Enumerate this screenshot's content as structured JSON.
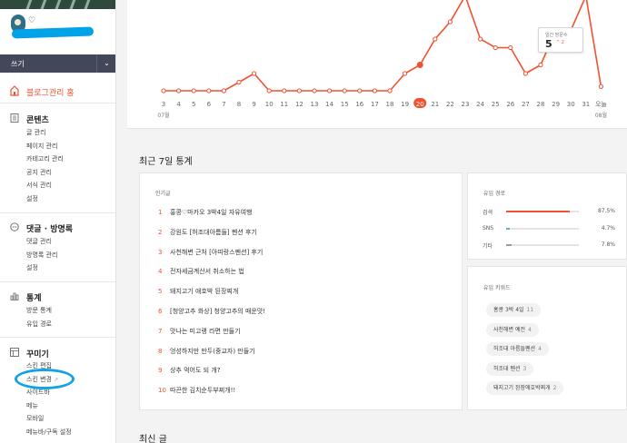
{
  "sidebar": {
    "profile_name": "♡",
    "write_label": "쓰기",
    "write_toggle": "⌄",
    "home_label": "블로그관리 홈",
    "sections": [
      {
        "title": "콘텐츠",
        "items": [
          "글 관리",
          "페이지 관리",
          "카테고리 관리",
          "공지 관리",
          "서식 관리",
          "설정"
        ]
      },
      {
        "title": "댓글 · 방명록",
        "items": [
          "댓글 관리",
          "방명록 관리",
          "설정"
        ]
      },
      {
        "title": "통계",
        "items": [
          "방문 통계",
          "유입 경로"
        ]
      },
      {
        "title": "꾸미기",
        "items": [
          "스킨 편집",
          "스킨 변경",
          "사이드바",
          "메뉴",
          "모바일",
          "메뉴바/구독 설정"
        ]
      }
    ]
  },
  "chart": {
    "tooltip_label": "일간 방문수",
    "tooltip_value": "5",
    "tooltip_delta": "^ 2",
    "highlight_label": "20",
    "month_start": "07월",
    "month_end": "08월"
  },
  "chart_data": {
    "type": "line",
    "x": [
      "3",
      "4",
      "5",
      "6",
      "7",
      "8",
      "9",
      "10",
      "11",
      "12",
      "13",
      "14",
      "15",
      "16",
      "17",
      "18",
      "19",
      "20",
      "21",
      "22",
      "23",
      "24",
      "25",
      "26",
      "27",
      "28",
      "29",
      "30",
      "31",
      "오늘"
    ],
    "series": [
      {
        "values": [
          0,
          0,
          0,
          0,
          0,
          1,
          2,
          0,
          0,
          0,
          0,
          0,
          0,
          0,
          0,
          0,
          2,
          3,
          6,
          8,
          11,
          6,
          5,
          5,
          2,
          3,
          7,
          7,
          11,
          0.5
        ]
      }
    ],
    "ylim": [
      0,
      12
    ],
    "highlight_index": 17,
    "line_color": "#f25130",
    "grid": false
  },
  "recent": {
    "section_title": "최근 7일 통계",
    "popular_title": "인기글",
    "posts": [
      {
        "num": "1",
        "title": "홍콩♡마카오 3박4일 자유여행"
      },
      {
        "num": "2",
        "title": "강원도 [허조대아름들] 펜션 후기"
      },
      {
        "num": "3",
        "title": "사천해변 근처 [아띠랑스펜션] 후기"
      },
      {
        "num": "4",
        "title": "전자세금계산서 취소하는 법"
      },
      {
        "num": "5",
        "title": "돼지고기 애호박 된장찌개"
      },
      {
        "num": "6",
        "title": "[청양고추 화상] 청양고추의 매운맛!"
      },
      {
        "num": "7",
        "title": "맛나는 미고랭 라면 만들기"
      },
      {
        "num": "8",
        "title": "엉성하지만 만두(중교자) 만들기"
      },
      {
        "num": "9",
        "title": "상추 먹어도 되 개?"
      },
      {
        "num": "10",
        "title": "따끈한 김치순두부찌개!!"
      }
    ],
    "referrer_title": "유입 경로",
    "referrers": [
      {
        "name": "검색",
        "pct": "87.5%",
        "value": 87.5,
        "color": "#f25130"
      },
      {
        "name": "SNS",
        "pct": "4.7%",
        "value": 4.7,
        "color": "#3fc1c9"
      },
      {
        "name": "기타",
        "pct": "7.8%",
        "value": 7.8,
        "color": "#9a9a9a"
      }
    ],
    "keyword_title": "유입 키워드",
    "keywords": [
      {
        "text": "홍콩 3박 4일",
        "count": "11"
      },
      {
        "text": "사천해변 예전",
        "count": "4"
      },
      {
        "text": "허조대 아름들펜션",
        "count": "4"
      },
      {
        "text": "허조대 펜션",
        "count": "3"
      },
      {
        "text": "돼지고기 된장애호박찌개",
        "count": "2"
      }
    ]
  },
  "latest": {
    "section_title": "최신 글"
  }
}
